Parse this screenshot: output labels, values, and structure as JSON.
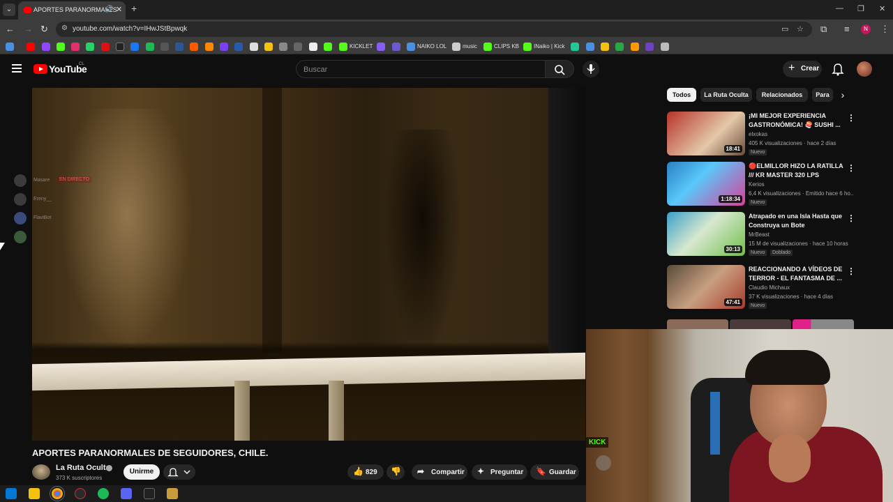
{
  "browser": {
    "tab_title": "APORTES PARANORMALES",
    "url": "youtube.com/watch?v=IHwJStBpwqk",
    "profile_initial": "N",
    "bookmarks": [
      {
        "label": "KICKLET",
        "color": "#53fc18"
      },
      {
        "label": "NAIKO LOL",
        "color": "#4a90e2"
      },
      {
        "label": "music",
        "color": "#cccccc"
      },
      {
        "label": "CLIPS KB",
        "color": "#53fc18"
      },
      {
        "label": "INaiko | Kick",
        "color": "#53fc18"
      }
    ]
  },
  "youtube": {
    "logo_text": "YouTube",
    "country_code": "CL",
    "search_placeholder": "Buscar",
    "create_label": "Crear"
  },
  "chat_overlay": [
    {
      "name": "Masare",
      "badge": "EN DIRECTO"
    },
    {
      "name": "Ereny__",
      "badge": ""
    },
    {
      "name": "FlaviBot",
      "badge": ""
    },
    {
      "name": "",
      "badge": ""
    }
  ],
  "video": {
    "title": "APORTES PARANORMALES DE SEGUIDORES, CHILE.",
    "channel": "La Ruta Oculta",
    "subscribers": "373 K suscriptores",
    "join_label": "Unirme",
    "likes": "829",
    "share_label": "Compartir",
    "ask_label": "Preguntar",
    "save_label": "Guardar"
  },
  "chips": [
    "Todos",
    "La Ruta Oculta",
    "Relacionados",
    "Para"
  ],
  "recommendations": [
    {
      "title": "¡MI MEJOR EXPERIENCIA GASTRONÓMICA! 🍣 SUSHI ...",
      "channel": "elxokas",
      "meta": "405 K visualizaciones · hace 2 días",
      "tag": "Nuevo",
      "tag2": "",
      "duration": "18:41",
      "thumb_a": "#b8322a",
      "thumb_b": "#e3c9a8"
    },
    {
      "title": "🔴ELMILLOR HIZO LA RATILLA /// KR MASTER 320 LPS",
      "channel": "Kerios",
      "meta": "6,4 K visualizaciones · Emitido hace 6 ho...",
      "tag": "Nuevo",
      "tag2": "",
      "duration": "1:18:34",
      "thumb_a": "#2a7fc4",
      "thumb_b": "#d83f9a"
    },
    {
      "title": "Atrapado en una Isla Hasta que Construya un Bote",
      "channel": "MrBeast",
      "meta": "15 M de visualizaciones · hace 10 horas",
      "tag": "Nuevo",
      "tag2": "Doblado",
      "duration": "30:13",
      "thumb_a": "#3aa0c8",
      "thumb_b": "#6fbf4a"
    },
    {
      "title": "REACCIONANDO A VÍDEOS DE TERROR - EL FANTASMA DE ...",
      "channel": "Claudio Michaux",
      "meta": "37 K visualizaciones · hace 4 días",
      "tag": "Nuevo",
      "tag2": "",
      "duration": "47:41",
      "thumb_a": "#5a4a3a",
      "thumb_b": "#a83a2a"
    }
  ],
  "webcam": {
    "overlay_brand": "KICK"
  }
}
